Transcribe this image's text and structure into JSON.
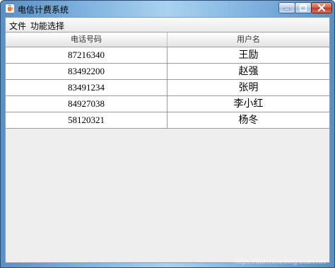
{
  "window": {
    "title": "电信计费系统",
    "app_icon": "java-cup-icon",
    "controls": [
      "minimize-icon",
      "maximize-icon",
      "close-icon"
    ]
  },
  "menubar": {
    "items": [
      {
        "label": "文件"
      },
      {
        "label": "功能选择"
      }
    ]
  },
  "table": {
    "columns": [
      "电话号码",
      "用户名"
    ],
    "rows": [
      {
        "phone": "87216340",
        "user": "王励"
      },
      {
        "phone": "83492200",
        "user": "赵强"
      },
      {
        "phone": "83491234",
        "user": "张明"
      },
      {
        "phone": "84927038",
        "user": "李小红"
      },
      {
        "phone": "58120321",
        "user": "杨冬"
      }
    ]
  },
  "watermark": "https://dahelow.blog.csdn.net"
}
